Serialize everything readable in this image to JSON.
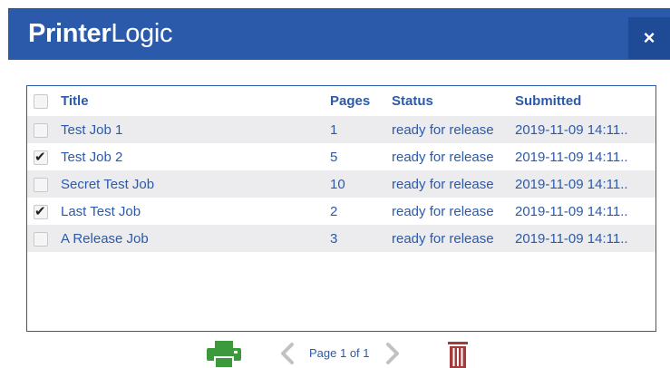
{
  "header": {
    "brand_bold": "Printer",
    "brand_light": "Logic",
    "close_label": "×"
  },
  "table": {
    "columns": [
      "Title",
      "Pages",
      "Status",
      "Submitted"
    ],
    "rows": [
      {
        "title": "Test Job 1",
        "pages": "1",
        "status": "ready for release",
        "submitted": "2019-11-09 14:11..",
        "checked": false
      },
      {
        "title": "Test Job 2",
        "pages": "5",
        "status": "ready for release",
        "submitted": "2019-11-09 14:11..",
        "checked": true
      },
      {
        "title": "Secret Test Job",
        "pages": "10",
        "status": "ready for release",
        "submitted": "2019-11-09 14:11..",
        "checked": false
      },
      {
        "title": "Last Test Job",
        "pages": "2",
        "status": "ready for release",
        "submitted": "2019-11-09 14:11..",
        "checked": true
      },
      {
        "title": "A Release Job",
        "pages": "3",
        "status": "ready for release",
        "submitted": "2019-11-09 14:11..",
        "checked": false
      }
    ]
  },
  "footer": {
    "page_label": "Page 1 of 1",
    "icons": [
      "print-icon",
      "chevron-left-icon",
      "chevron-right-icon",
      "trash-icon"
    ]
  },
  "colors": {
    "brand_blue": "#2b5aaa",
    "print_green": "#3c9a3c",
    "trash_red": "#a53a3a",
    "row_alt": "#ececef"
  }
}
